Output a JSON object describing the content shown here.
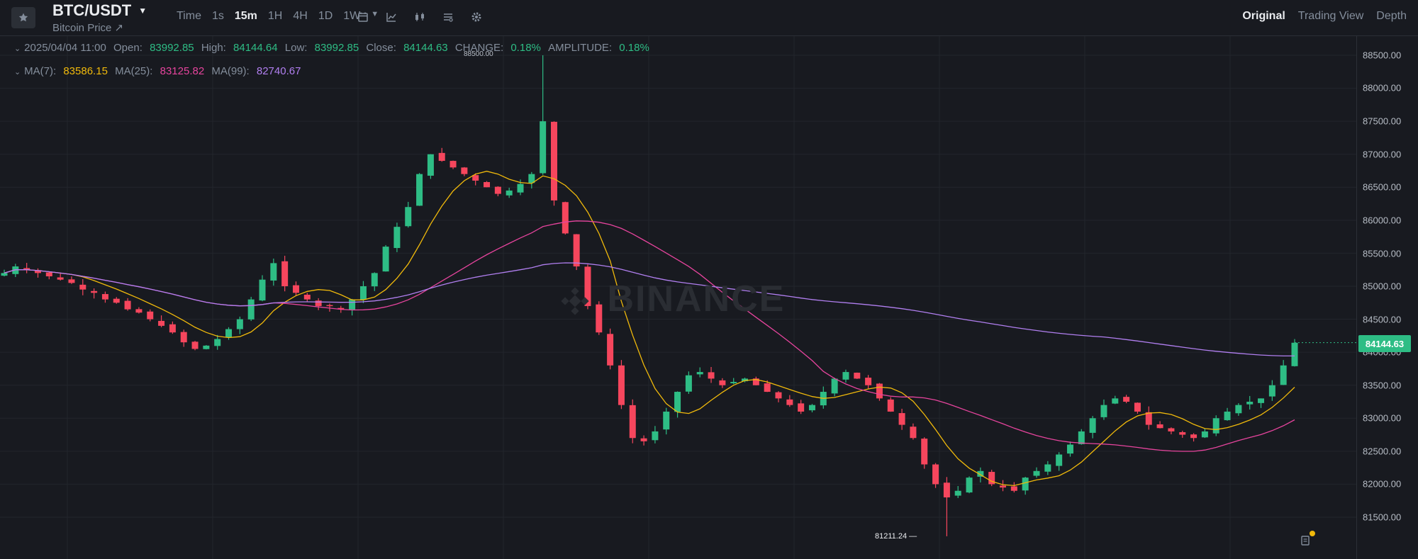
{
  "header": {
    "pair": "BTC/USDT",
    "subtitle": "Bitcoin Price ↗",
    "intervals": [
      "Time",
      "1s",
      "15m",
      "1H",
      "4H",
      "1D",
      "1W"
    ],
    "active_interval": "15m",
    "views": [
      "Original",
      "Trading View",
      "Depth"
    ],
    "active_view": "Original",
    "tool_icons": [
      "calendar-icon",
      "indicator-icon",
      "candle-type-icon",
      "layout-icon",
      "settings-icon"
    ]
  },
  "legend": {
    "datetime": "2025/04/04 11:00",
    "open_label": "Open:",
    "open": "83992.85",
    "high_label": "High:",
    "high": "84144.64",
    "low_label": "Low:",
    "low": "83992.85",
    "close_label": "Close:",
    "close": "84144.63",
    "change_label": "CHANGE:",
    "change": "0.18%",
    "amplitude_label": "AMPLITUDE:",
    "amplitude": "0.18%",
    "ma7_label": "MA(7):",
    "ma7": "83586.15",
    "ma25_label": "MA(25):",
    "ma25": "83125.82",
    "ma99_label": "MA(99):",
    "ma99": "82740.67"
  },
  "chart": {
    "watermark": "BINANCE",
    "current_price": "84144.63",
    "high_marker": "88500.00",
    "low_marker": "81211.24",
    "y_ticks": [
      "88500.00",
      "88000.00",
      "87500.00",
      "87000.00",
      "86500.00",
      "86000.00",
      "85500.00",
      "85000.00",
      "84500.00",
      "84000.00",
      "83500.00",
      "83000.00",
      "82500.00",
      "82000.00",
      "81500.00"
    ],
    "colors": {
      "up": "#2ebd85",
      "down": "#f6465d",
      "ma7": "#f0b90b",
      "ma25": "#e6449d",
      "ma99": "#b17ff0"
    }
  },
  "chart_data": {
    "type": "candlestick",
    "y_range": [
      81200,
      88700
    ],
    "closes_approx": [
      85200,
      85300,
      85250,
      85200,
      85150,
      85100,
      85050,
      84950,
      84900,
      84800,
      84750,
      84650,
      84600,
      84500,
      84400,
      84300,
      84150,
      84050,
      84100,
      84200,
      84350,
      84500,
      84800,
      85100,
      85350,
      85000,
      84900,
      84800,
      84700,
      84700,
      84650,
      84800,
      85000,
      85200,
      85600,
      85900,
      86200,
      86700,
      87000,
      86900,
      86800,
      86700,
      86600,
      86500,
      86400,
      86450,
      86550,
      86700,
      87500,
      86300,
      85800,
      85300,
      84700,
      84300,
      83800,
      83200,
      82700,
      82650,
      82800,
      83100,
      83400,
      83650,
      83700,
      83600,
      83500,
      83550,
      83600,
      83500,
      83400,
      83300,
      83200,
      83100,
      83200,
      83400,
      83600,
      83700,
      83600,
      83500,
      83300,
      83100,
      82900,
      82700,
      82300,
      82000,
      81800,
      81900,
      82100,
      82200,
      82000,
      81950,
      81900,
      82100,
      82200,
      82300,
      82450,
      82600,
      82800,
      83000,
      83200,
      83300,
      83250,
      83100,
      82900,
      82850,
      82800,
      82750,
      82700,
      82800,
      83000,
      83100,
      83200,
      83250,
      83300,
      83500,
      83800,
      84144
    ]
  }
}
